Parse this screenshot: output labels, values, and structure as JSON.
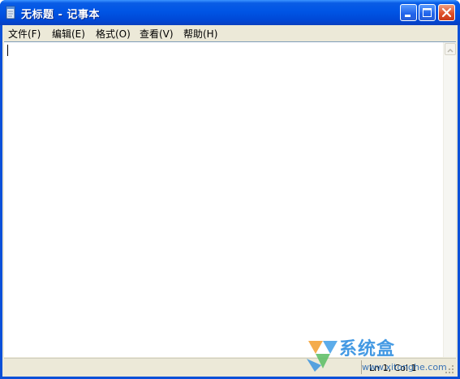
{
  "window": {
    "title": "无标题 - 记事本"
  },
  "menubar": {
    "items": [
      {
        "label": "文件(F)"
      },
      {
        "label": "编辑(E)"
      },
      {
        "label": "格式(O)"
      },
      {
        "label": "查看(V)"
      },
      {
        "label": "帮助(H)"
      }
    ]
  },
  "editor": {
    "content": ""
  },
  "statusbar": {
    "position": "Ln 1, Col 1"
  },
  "watermark": {
    "brand": "系统盒",
    "url": "www.xitonghe.com"
  },
  "icons": [
    "notepad-icon",
    "minimize-icon",
    "maximize-icon",
    "close-icon",
    "scroll-up-icon",
    "resize-grip-icon",
    "watermark-logo-icon"
  ],
  "colors": {
    "titlebar": "#0055e5",
    "close_button": "#e0502a",
    "chrome": "#ece9d8"
  }
}
